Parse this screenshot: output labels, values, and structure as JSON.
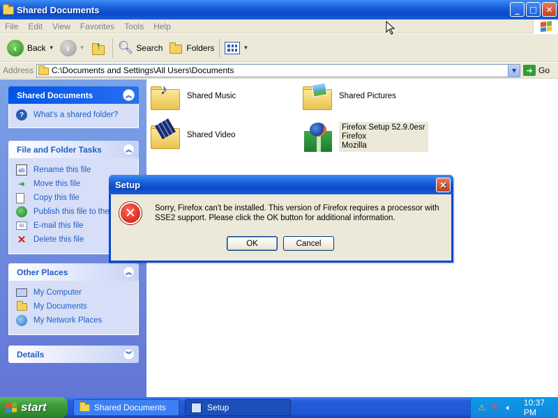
{
  "window": {
    "title": "Shared Documents",
    "buttons": {
      "minimize": "_",
      "maximize": "□",
      "close": "✕"
    }
  },
  "menu": [
    "File",
    "Edit",
    "View",
    "Favorites",
    "Tools",
    "Help"
  ],
  "toolbar": {
    "back_label": "Back",
    "search_label": "Search",
    "folders_label": "Folders"
  },
  "address": {
    "label": "Address",
    "path": "C:\\Documents and Settings\\All Users\\Documents",
    "go_label": "Go"
  },
  "left_pane": {
    "shared_docs": {
      "header": "Shared Documents",
      "items": [
        {
          "label": "What's a shared folder?",
          "icon": "help-icon"
        }
      ]
    },
    "file_tasks": {
      "header": "File and Folder Tasks",
      "items": [
        {
          "label": "Rename this file",
          "icon": "rename-icon"
        },
        {
          "label": "Move this file",
          "icon": "move-icon"
        },
        {
          "label": "Copy this file",
          "icon": "copy-icon"
        },
        {
          "label": "Publish this file to the Web",
          "icon": "globe-icon"
        },
        {
          "label": "E-mail this file",
          "icon": "email-icon"
        },
        {
          "label": "Delete this file",
          "icon": "delete-icon"
        }
      ]
    },
    "other_places": {
      "header": "Other Places",
      "items": [
        {
          "label": "My Computer",
          "icon": "computer-icon"
        },
        {
          "label": "My Documents",
          "icon": "documents-folder-icon"
        },
        {
          "label": "My Network Places",
          "icon": "network-icon"
        }
      ]
    },
    "details": {
      "header": "Details"
    }
  },
  "files": [
    {
      "name": "Shared Music",
      "icon": "music-folder-icon"
    },
    {
      "name": "Shared Pictures",
      "icon": "pictures-folder-icon"
    },
    {
      "name": "Shared Video",
      "icon": "video-folder-icon"
    },
    {
      "name": "Firefox Setup 52.9.0esr",
      "line2": "Firefox",
      "line3": "Mozilla",
      "icon": "firefox-installer-icon"
    }
  ],
  "dialog": {
    "title": "Setup",
    "message": "Sorry, Firefox can't be installed. This version of Firefox requires a processor with SSE2 support. Please click the OK button for additional information.",
    "ok_label": "OK",
    "cancel_label": "Cancel"
  },
  "taskbar": {
    "start_label": "start",
    "items": [
      {
        "label": "Shared Documents",
        "icon": "folder-icon"
      },
      {
        "label": "Setup",
        "icon": "setup-icon"
      }
    ],
    "clock": "10:37 PM"
  }
}
